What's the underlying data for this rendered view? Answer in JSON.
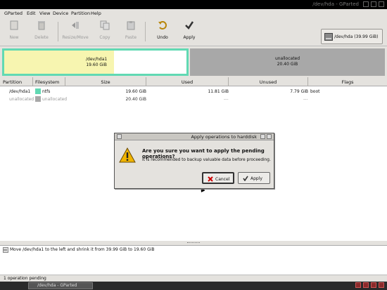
{
  "window": {
    "title": "/dev/hda - GParted"
  },
  "menu": [
    "GParted",
    "Edit",
    "View",
    "Device",
    "Partition",
    "Help"
  ],
  "toolbar": {
    "new": "New",
    "delete": "Delete",
    "resize": "Resize/Move",
    "copy": "Copy",
    "paste": "Paste",
    "undo": "Undo",
    "apply": "Apply"
  },
  "device_selector": {
    "label": "/dev/hda   (39.99 GiB)"
  },
  "partition_map": {
    "p1_name": "/dev/hda1",
    "p1_size": "19.60 GiB",
    "unalloc_name": "unallocated",
    "unalloc_size": "20.40 GiB"
  },
  "table": {
    "headers": [
      "Partition",
      "Filesystem",
      "Size",
      "Used",
      "Unused",
      "Flags"
    ],
    "rows": [
      {
        "partition": "/dev/hda1",
        "filesystem": "ntfs",
        "size": "19.60 GiB",
        "used": "11.81 GiB",
        "unused": "7.79 GiB",
        "flags": "boot"
      },
      {
        "partition": "unallocated",
        "filesystem": "unallocated",
        "size": "20.40 GiB",
        "used": "---",
        "unused": "---",
        "flags": ""
      }
    ]
  },
  "dialog": {
    "title": "Apply operations to harddisk",
    "heading": "Are you sure you want to apply the pending operations?",
    "message": "It is recommended to backup valuable data before proceeding.",
    "cancel": "Cancel",
    "apply": "Apply"
  },
  "operations": [
    "Move /dev/hda1 to the left and shrink it from 39.99 GiB to 19.60 GiB"
  ],
  "status": "1 operation pending",
  "taskbar": {
    "task": "/dev/hda - GParted"
  },
  "colors": {
    "ntfs": "#61d9b3",
    "used_fill": "#f7f5b0",
    "unallocated": "#a8a8a8",
    "warning": "#f0b400"
  }
}
